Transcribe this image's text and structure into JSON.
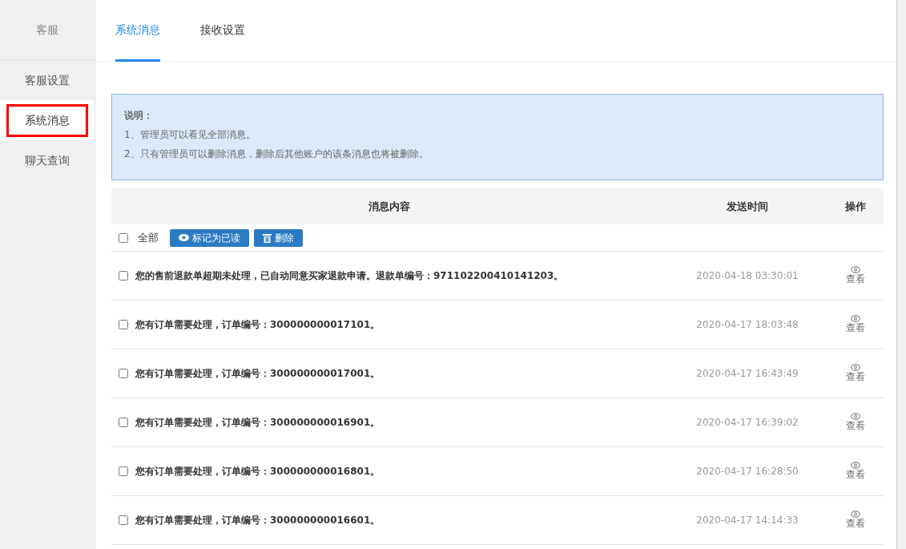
{
  "sidebar": {
    "title": "客服",
    "items": [
      {
        "label": "客服设置",
        "selected": false
      },
      {
        "label": "系统消息",
        "selected": true
      },
      {
        "label": "聊天查询",
        "selected": false
      }
    ]
  },
  "tabs": [
    {
      "label": "系统消息",
      "selected": true
    },
    {
      "label": "接收设置",
      "selected": false
    }
  ],
  "notice": {
    "title": "说明：",
    "lines": [
      "1、管理员可以看见全部消息。",
      "2、只有管理员可以删除消息，删除后其他账户的该条消息也将被删除。"
    ]
  },
  "table": {
    "columns": [
      "消息内容",
      "发送时间",
      "操作"
    ],
    "toolbar": {
      "select_all_label": "全部",
      "checked": false,
      "buttons": [
        {
          "kind": "read",
          "label": "标记为已读"
        },
        {
          "kind": "delete",
          "label": "删除"
        }
      ]
    },
    "rows": [
      {
        "checked": false,
        "content": "您的售前退款单超期未处理，已自动同意买家退款申请。退款单编号：971102200410141203。",
        "time": "2020-04-18 03:30:01",
        "action": "查看"
      },
      {
        "checked": false,
        "content": "您有订单需要处理，订单编号：300000000017101。",
        "time": "2020-04-17 18:03:48",
        "action": "查看"
      },
      {
        "checked": false,
        "content": "您有订单需要处理，订单编号：300000000017001。",
        "time": "2020-04-17 16:43:49",
        "action": "查看"
      },
      {
        "checked": false,
        "content": "您有订单需要处理，订单编号：300000000016901。",
        "time": "2020-04-17 16:39:02",
        "action": "查看"
      },
      {
        "checked": false,
        "content": "您有订单需要处理，订单编号：300000000016801。",
        "time": "2020-04-17 16:28:50",
        "action": "查看"
      },
      {
        "checked": false,
        "content": "您有订单需要处理，订单编号：300000000016601。",
        "time": "2020-04-17 14:14:33",
        "action": "查看"
      }
    ]
  }
}
